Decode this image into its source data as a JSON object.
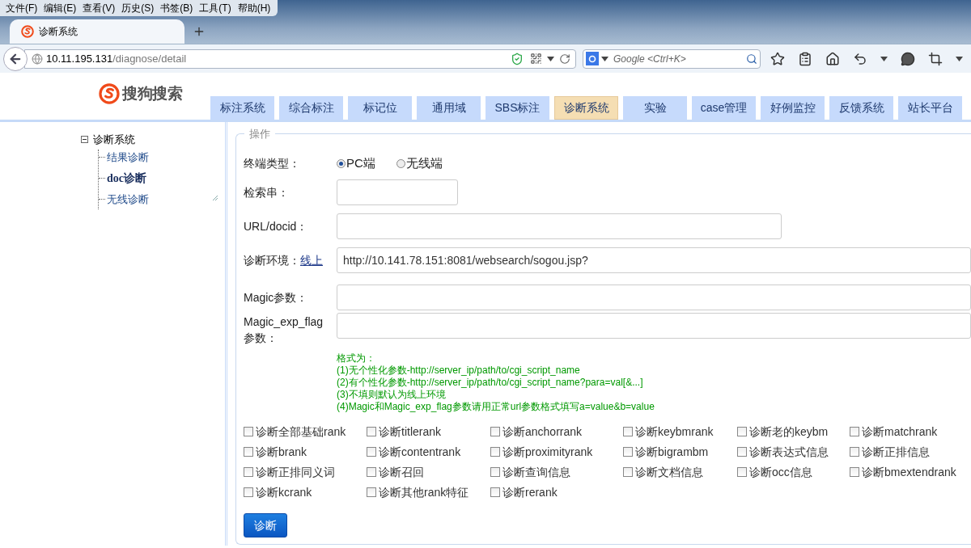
{
  "browser": {
    "menu": [
      "文件(F)",
      "编辑(E)",
      "查看(V)",
      "历史(S)",
      "书签(B)",
      "工具(T)",
      "帮助(H)"
    ],
    "tab": {
      "title": "诊断系统"
    },
    "address": {
      "host": "10.11.195.131",
      "path": "/diagnose/detail"
    },
    "search": {
      "placeholder": "Google <Ctrl+K>"
    }
  },
  "page": {
    "logo": "搜狗搜索",
    "nav_tabs": [
      {
        "label": "标注系统",
        "selected": false
      },
      {
        "label": "综合标注",
        "selected": false
      },
      {
        "label": "标记位",
        "selected": false
      },
      {
        "label": "通用域",
        "selected": false
      },
      {
        "label": "SBS标注",
        "selected": false
      },
      {
        "label": "诊断系统",
        "selected": true
      },
      {
        "label": "实验",
        "selected": false
      },
      {
        "label": "case管理",
        "selected": false
      },
      {
        "label": "好例监控",
        "selected": false
      },
      {
        "label": "反馈系统",
        "selected": false
      },
      {
        "label": "站长平台",
        "selected": false
      }
    ],
    "tree": {
      "label": "诊断系统",
      "expanded": true,
      "children": [
        {
          "label": "结果诊断",
          "selected": false
        },
        {
          "label": "doc诊断",
          "selected": true
        },
        {
          "label": "无线诊断",
          "selected": false
        }
      ]
    },
    "form": {
      "legend": "操作",
      "terminal": {
        "label": "终端类型：",
        "options": [
          {
            "label": "PC端",
            "selected": true
          },
          {
            "label": "无线端",
            "selected": false
          }
        ]
      },
      "query": {
        "label": "检索串："
      },
      "url_docid": {
        "label": "URL/docid："
      },
      "environment": {
        "label": "诊断环境：",
        "link": "线上",
        "value": "http://10.141.78.151:8081/websearch/sogou.jsp?"
      },
      "magic": {
        "label": "Magic参数："
      },
      "magic_exp_flag": {
        "label": "Magic_exp_flag参数："
      },
      "hint": [
        "格式为：",
        "(1)无个性化参数-http://server_ip/path/to/cgi_script_name",
        "(2)有个性化参数-http://server_ip/path/to/cgi_script_name?para=val[&...]",
        "(3)不填则默认为线上环境",
        "(4)Magic和Magic_exp_flag参数请用正常url参数格式填写a=value&b=value"
      ],
      "options": [
        {
          "label": "诊断全部基础rank",
          "checked": false
        },
        {
          "label": "诊断titlerank",
          "checked": false
        },
        {
          "label": "诊断anchorrank",
          "checked": false
        },
        {
          "label": "诊断keybmrank",
          "checked": false
        },
        {
          "label": "诊断老的keybm",
          "checked": false
        },
        {
          "label": "诊断matchrank",
          "checked": false
        },
        {
          "label": "诊断brank",
          "checked": false
        },
        {
          "label": "诊断contentrank",
          "checked": false
        },
        {
          "label": "诊断proximityrank",
          "checked": false
        },
        {
          "label": "诊断bigrambm",
          "checked": false
        },
        {
          "label": "诊断表达式信息",
          "checked": false
        },
        {
          "label": "诊断正排信息",
          "checked": false
        },
        {
          "label": "诊断正排同义词",
          "checked": false
        },
        {
          "label": "诊断召回",
          "checked": false
        },
        {
          "label": "诊断查询信息",
          "checked": false
        },
        {
          "label": "诊断文档信息",
          "checked": false
        },
        {
          "label": "诊断occ信息",
          "checked": false
        },
        {
          "label": "诊断bmextendrank",
          "checked": false
        },
        {
          "label": "诊断kcrank",
          "checked": false
        },
        {
          "label": "诊断其他rank特征",
          "checked": false
        },
        {
          "label": "诊断rerank",
          "checked": false
        }
      ],
      "submit": "诊断"
    }
  }
}
